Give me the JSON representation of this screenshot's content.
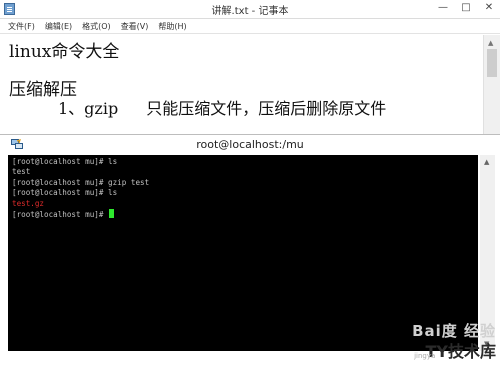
{
  "notepad": {
    "title": "讲解.txt - 记事本",
    "controls": {
      "minimize": "—",
      "maximize": "□",
      "close": "✕"
    },
    "menu": [
      "文件(F)",
      "编辑(E)",
      "格式(O)",
      "查看(V)",
      "帮助(H)"
    ],
    "lines": {
      "line1": "linux命令大全",
      "line2": "压缩解压",
      "line3_num": "1、gzip",
      "line3_desc": "只能压缩文件，压缩后删除原文件"
    }
  },
  "putty": {
    "title": "root@localhost:/mu",
    "lines": [
      "[root@localhost mu]# ls",
      "test",
      "[root@localhost mu]# gzip test",
      "[root@localhost mu]# ls",
      "test.gz"
    ],
    "prompt": "[root@localhost mu]# ",
    "highlight_color": "#dd2b2b",
    "cursor_color": "#2ee82e"
  },
  "watermark": {
    "top": "Bai度 经验",
    "small": "jingya",
    "bottom": "TY技术库"
  }
}
